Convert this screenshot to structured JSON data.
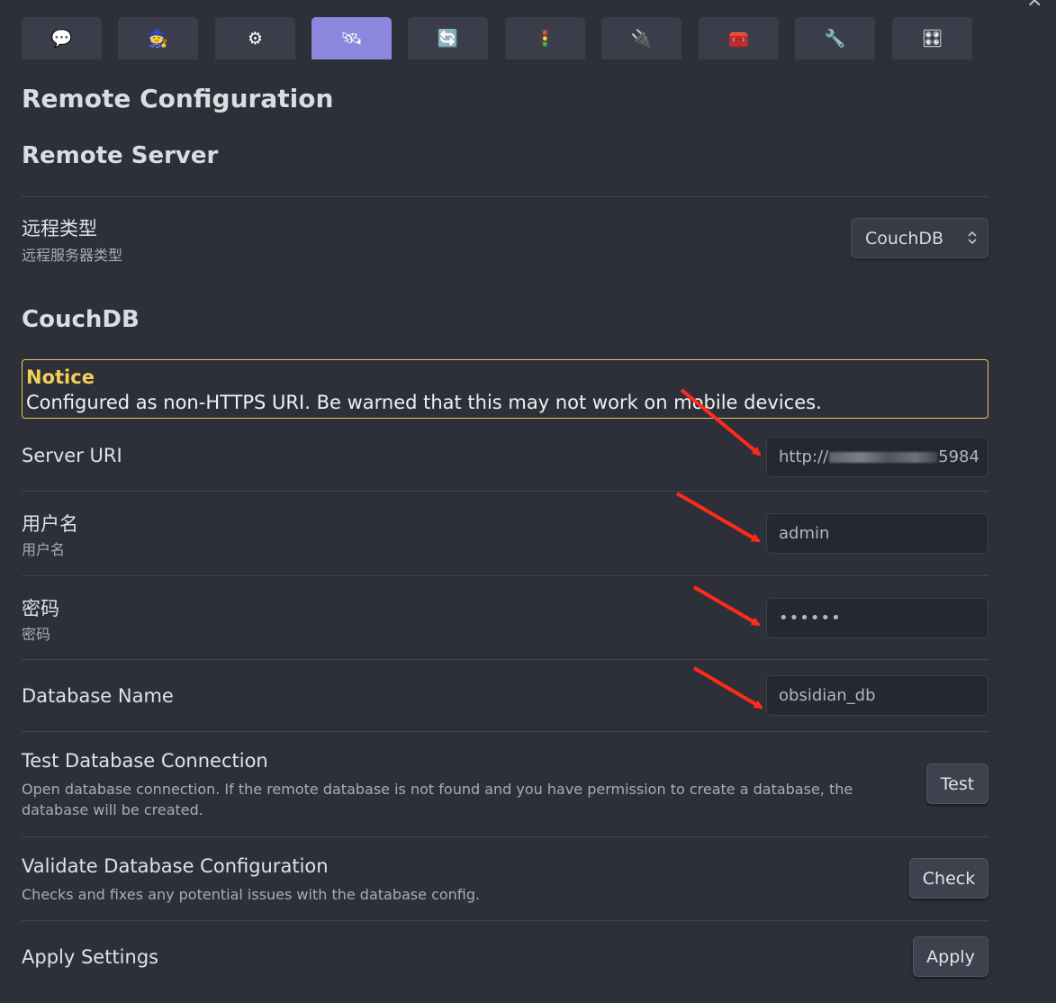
{
  "window": {
    "close_glyph": "×"
  },
  "tabs": [
    {
      "icon": "speech-bubble-icon",
      "glyph": "💬",
      "active": false
    },
    {
      "icon": "wizard-icon",
      "glyph": "🧙",
      "active": false
    },
    {
      "icon": "gear-icon",
      "glyph": "⚙",
      "active": false
    },
    {
      "icon": "satellite-icon",
      "glyph": "🛰",
      "active": true
    },
    {
      "icon": "sync-icon",
      "glyph": "🔄",
      "active": false
    },
    {
      "icon": "traffic-light-icon",
      "glyph": "🚦",
      "active": false
    },
    {
      "icon": "plug-icon",
      "glyph": "🔌",
      "active": false
    },
    {
      "icon": "toolbox-icon",
      "glyph": "🧰",
      "active": false
    },
    {
      "icon": "wrench-icon",
      "glyph": "🔧",
      "active": false
    },
    {
      "icon": "control-knobs-icon",
      "glyph": "🎛",
      "active": false
    }
  ],
  "page_title": "Remote Configuration",
  "remote_server": {
    "heading": "Remote Server",
    "remote_type": {
      "label": "远程类型",
      "description": "远程服务器类型",
      "value": "CouchDB"
    }
  },
  "couchdb": {
    "heading": "CouchDB",
    "notice": {
      "title": "Notice",
      "text": "Configured as non-HTTPS URI. Be warned that this may not work on mobile devices."
    },
    "server_uri": {
      "label": "Server URI",
      "value_prefix": "http://",
      "value_suffix": "5984"
    },
    "username": {
      "label": "用户名",
      "description": "用户名",
      "value": "admin"
    },
    "password": {
      "label": "密码",
      "description": "密码",
      "value": "••••••"
    },
    "database_name": {
      "label": "Database Name",
      "value": "obsidian_db"
    },
    "test_connection": {
      "label": "Test Database Connection",
      "description": "Open database connection. If the remote database is not found and you have permission to create a database, the database will be created.",
      "button": "Test"
    },
    "validate_config": {
      "label": "Validate Database Configuration",
      "description": "Checks and fixes any potential issues with the database config.",
      "button": "Check"
    },
    "apply_settings": {
      "label": "Apply Settings",
      "button": "Apply"
    }
  },
  "colors": {
    "background": "#2e3039",
    "tab": "#3b3e4a",
    "tab_active": "#8a87dc",
    "notice_border": "#e7c85a",
    "notice_title": "#f3cf55",
    "annotation_arrow": "#ff2a1a"
  }
}
